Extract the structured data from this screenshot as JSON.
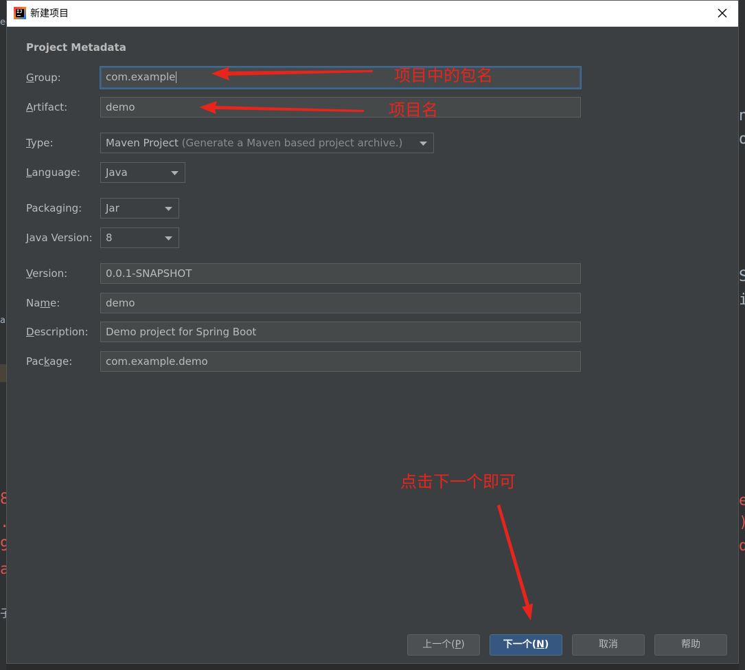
{
  "window": {
    "title": "新建项目",
    "app_icon": "intellij-icon",
    "app_icon_text": "IJ",
    "close_icon": "close-icon"
  },
  "section_title": "Project Metadata",
  "fields": {
    "group": {
      "label_pre": "",
      "label_key": "G",
      "label_post": "roup:",
      "value": "com.example"
    },
    "artifact": {
      "label_pre": "",
      "label_key": "A",
      "label_post": "rtifact:",
      "value": "demo"
    },
    "type": {
      "label_pre": "",
      "label_key": "T",
      "label_post": "ype:",
      "value": "Maven Project",
      "hint": "(Generate a Maven based project archive.)"
    },
    "language": {
      "label_pre": "",
      "label_key": "L",
      "label_post": "anguage:",
      "value": "Java"
    },
    "packaging": {
      "label_pre": "Packaging:",
      "label_key": "",
      "label_post": "",
      "value": "Jar"
    },
    "java_version": {
      "label_pre": "",
      "label_key": "J",
      "label_post": "ava Version:",
      "value": "8"
    },
    "version": {
      "label_pre": "",
      "label_key": "V",
      "label_post": "ersion:",
      "value": "0.0.1-SNAPSHOT"
    },
    "name": {
      "label_pre": "Na",
      "label_key": "m",
      "label_post": "e:",
      "value": "demo"
    },
    "description": {
      "label_pre": "",
      "label_key": "D",
      "label_post": "escription:",
      "value": "Demo project for Spring Boot"
    },
    "package": {
      "label_pre": "Pac",
      "label_key": "k",
      "label_post": "age:",
      "value": "com.example.demo"
    }
  },
  "buttons": {
    "previous": {
      "pre": "上一个(",
      "key": "P",
      "post": ")"
    },
    "next": {
      "pre": "下一个(",
      "key": "N",
      "post": ")"
    },
    "cancel": "取消",
    "help": "帮助"
  },
  "annotations": {
    "group": "项目中的包名",
    "artifact": "项目名",
    "next": "点击下一个即可"
  },
  "background_fragments": {
    "left": [
      "ed",
      "8",
      ".",
      "9",
      "a",
      "子",
      "al"
    ],
    "right": [
      "n",
      "o",
      "S",
      "i",
      "e",
      ")",
      "d"
    ]
  },
  "colors": {
    "dialog_bg": "#3c3f41",
    "field_bg": "#45494a",
    "primary_button": "#365880",
    "annotation": "#e8251d"
  }
}
